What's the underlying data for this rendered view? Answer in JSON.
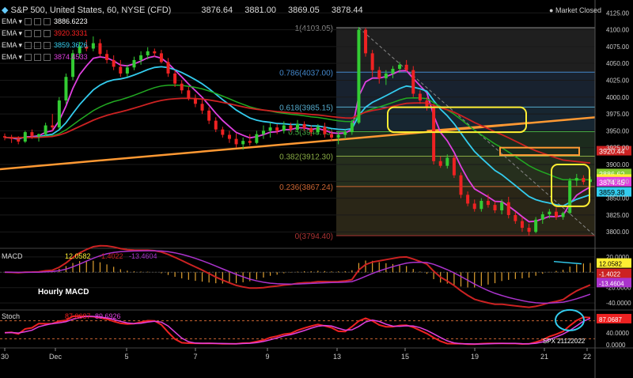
{
  "header": {
    "symbol_title": "S&P 500, United States, 60, NYSE (CFD)",
    "ohlc": [
      "3876.64",
      "3881.00",
      "3869.05",
      "3878.44"
    ],
    "market_status": "Market Closed"
  },
  "indicators": [
    {
      "label": "EMA",
      "value": "3886.6223",
      "color": "#ffffff"
    },
    {
      "label": "EMA",
      "value": "3920.3331",
      "color": "#ff2222"
    },
    {
      "label": "EMA",
      "value": "3859.3626",
      "color": "#33ccee"
    },
    {
      "label": "EMA",
      "value": "3874.4533",
      "color": "#e040e0"
    }
  ],
  "colors": {
    "up": "#33cc33",
    "down": "#ee2222",
    "ema_fast": "#e040e0",
    "ema_mid": "#33ccee",
    "ema_slow": "#cc2222",
    "ema_green": "#22aa22",
    "trend": "#ff9933",
    "highlight": "#ffee33",
    "circle": "#33ccee"
  },
  "chart_data": [
    {
      "type": "candlestick",
      "panel": "price",
      "x_ticks": [
        "30",
        "Dec",
        "5",
        "7",
        "9",
        "13",
        "15",
        "19",
        "21",
        "22"
      ],
      "y_ticks": [
        4125,
        4100,
        4075,
        4050,
        4025,
        4000,
        3975,
        3950,
        3925,
        3900,
        3875,
        3850,
        3825,
        3800
      ],
      "ylim": [
        3785,
        4130
      ],
      "fibonacci": [
        {
          "label": "1(4103.05)",
          "value": 4103.05
        },
        {
          "label": "0.786(4037.00)",
          "value": 4037.0
        },
        {
          "label": "0.618(3985.15)",
          "value": 3985.15
        },
        {
          "label": "0.5(3948.73)",
          "value": 3948.73
        },
        {
          "label": "0.382(3912.30)",
          "value": 3912.3
        },
        {
          "label": "0.236(3867.24)",
          "value": 3867.24
        },
        {
          "label": "0(3794.40)",
          "value": 3794.4
        }
      ],
      "price_tags": [
        {
          "label": "3920.44",
          "value": 3920.44,
          "bg": "#cc2222",
          "fg": "#ffffff"
        },
        {
          "label": "3886.62",
          "value": 3886.62,
          "bg": "#88cc33",
          "fg": "#ffffff"
        },
        {
          "label": "3878.44",
          "value": 3878.44,
          "bg": "#ffee33",
          "fg": "#000000"
        },
        {
          "label": "3874.45",
          "value": 3874.45,
          "bg": "#e040e0",
          "fg": "#ffffff"
        },
        {
          "label": "3859.38",
          "value": 3859.38,
          "bg": "#33ccee",
          "fg": "#000000"
        }
      ],
      "candles": [
        [
          3942,
          3946,
          3936,
          3940
        ],
        [
          3940,
          3944,
          3932,
          3938
        ],
        [
          3938,
          3942,
          3930,
          3934
        ],
        [
          3934,
          3950,
          3932,
          3948
        ],
        [
          3948,
          3952,
          3938,
          3942
        ],
        [
          3942,
          3946,
          3934,
          3945
        ],
        [
          3945,
          3962,
          3942,
          3958
        ],
        [
          3958,
          3975,
          3950,
          3955
        ],
        [
          3955,
          4000,
          3952,
          3995
        ],
        [
          3995,
          4035,
          3990,
          4030
        ],
        [
          4030,
          4070,
          4025,
          4065
        ],
        [
          4065,
          4082,
          4058,
          4075
        ],
        [
          4075,
          4085,
          4068,
          4072
        ],
        [
          4072,
          4090,
          4068,
          4080
        ],
        [
          4080,
          4086,
          4060,
          4064
        ],
        [
          4064,
          4070,
          4050,
          4055
        ],
        [
          4055,
          4062,
          4040,
          4045
        ],
        [
          4045,
          4055,
          4030,
          4035
        ],
        [
          4035,
          4048,
          4030,
          4044
        ],
        [
          4044,
          4060,
          4040,
          4055
        ],
        [
          4055,
          4068,
          4048,
          4062
        ],
        [
          4062,
          4074,
          4056,
          4068
        ],
        [
          4068,
          4072,
          4060,
          4065
        ],
        [
          4065,
          4070,
          4050,
          4052
        ],
        [
          4052,
          4058,
          4030,
          4035
        ],
        [
          4035,
          4040,
          4015,
          4020
        ],
        [
          4020,
          4025,
          4005,
          4010
        ],
        [
          4010,
          4015,
          3995,
          3998
        ],
        [
          3998,
          4004,
          3985,
          3990
        ],
        [
          3990,
          3996,
          3975,
          3980
        ],
        [
          3980,
          3985,
          3960,
          3965
        ],
        [
          3965,
          3970,
          3948,
          3952
        ],
        [
          3952,
          3956,
          3940,
          3944
        ],
        [
          3944,
          3950,
          3932,
          3938
        ],
        [
          3938,
          3946,
          3925,
          3930
        ],
        [
          3930,
          3940,
          3922,
          3935
        ],
        [
          3935,
          3945,
          3928,
          3932
        ],
        [
          3932,
          3950,
          3930,
          3945
        ],
        [
          3945,
          3958,
          3938,
          3950
        ],
        [
          3950,
          3962,
          3940,
          3955
        ],
        [
          3955,
          3960,
          3945,
          3950
        ],
        [
          3950,
          3964,
          3946,
          3958
        ],
        [
          3958,
          3962,
          3948,
          3952
        ],
        [
          3952,
          3966,
          3948,
          3960
        ],
        [
          3960,
          3964,
          3950,
          3954
        ],
        [
          3954,
          3958,
          3942,
          3948
        ],
        [
          3948,
          3960,
          3944,
          3956
        ],
        [
          3956,
          3962,
          3940,
          3945
        ],
        [
          3945,
          3950,
          3935,
          3940
        ],
        [
          3940,
          3948,
          3930,
          3944
        ],
        [
          3944,
          3952,
          3938,
          3948
        ],
        [
          3948,
          3966,
          3944,
          3962
        ],
        [
          3962,
          4104,
          3960,
          4100
        ],
        [
          4100,
          4103,
          4060,
          4065
        ],
        [
          4065,
          4070,
          4030,
          4040
        ],
        [
          4040,
          4045,
          4020,
          4028
        ],
        [
          4028,
          4040,
          4018,
          4035
        ],
        [
          4035,
          4046,
          4028,
          4042
        ],
        [
          4042,
          4052,
          4036,
          4048
        ],
        [
          4048,
          4055,
          4038,
          4040
        ],
        [
          4040,
          4046,
          4000,
          4005
        ],
        [
          4005,
          4010,
          3990,
          3995
        ],
        [
          3995,
          4000,
          3980,
          3985
        ],
        [
          3985,
          3990,
          3900,
          3905
        ],
        [
          3905,
          3912,
          3895,
          3898
        ],
        [
          3898,
          3915,
          3894,
          3910
        ],
        [
          3910,
          3914,
          3880,
          3884
        ],
        [
          3884,
          3888,
          3850,
          3855
        ],
        [
          3855,
          3860,
          3838,
          3842
        ],
        [
          3842,
          3848,
          3830,
          3834
        ],
        [
          3834,
          3850,
          3830,
          3846
        ],
        [
          3846,
          3856,
          3836,
          3840
        ],
        [
          3840,
          3845,
          3828,
          3832
        ],
        [
          3832,
          3848,
          3826,
          3844
        ],
        [
          3844,
          3852,
          3820,
          3825
        ],
        [
          3825,
          3830,
          3812,
          3816
        ],
        [
          3816,
          3822,
          3800,
          3806
        ],
        [
          3806,
          3812,
          3795,
          3800
        ],
        [
          3800,
          3822,
          3798,
          3818
        ],
        [
          3818,
          3830,
          3812,
          3826
        ],
        [
          3826,
          3834,
          3820,
          3830
        ],
        [
          3830,
          3836,
          3818,
          3822
        ],
        [
          3822,
          3830,
          3818,
          3828
        ],
        [
          3828,
          3880,
          3826,
          3876
        ],
        [
          3876,
          3886,
          3868,
          3880
        ],
        [
          3880,
          3884,
          3870,
          3874
        ],
        [
          3874,
          3882,
          3866,
          3878
        ]
      ]
    },
    {
      "type": "macd",
      "panel": "macd",
      "title": "MACD",
      "values": [
        "12.0582",
        "-1.4022",
        "-13.4604"
      ],
      "annotation": "Hourly MACD",
      "y_ticks": [
        20,
        0,
        -20,
        -40
      ],
      "ylim": [
        -45,
        25
      ]
    },
    {
      "type": "stochastic",
      "panel": "stoch",
      "title": "Stoch",
      "values": [
        "87.0687",
        "89.6926"
      ],
      "y_ticks": [
        80,
        40,
        0
      ],
      "ylim": [
        0,
        100
      ]
    }
  ],
  "footer": {
    "watermark": "SPX 21122022"
  }
}
